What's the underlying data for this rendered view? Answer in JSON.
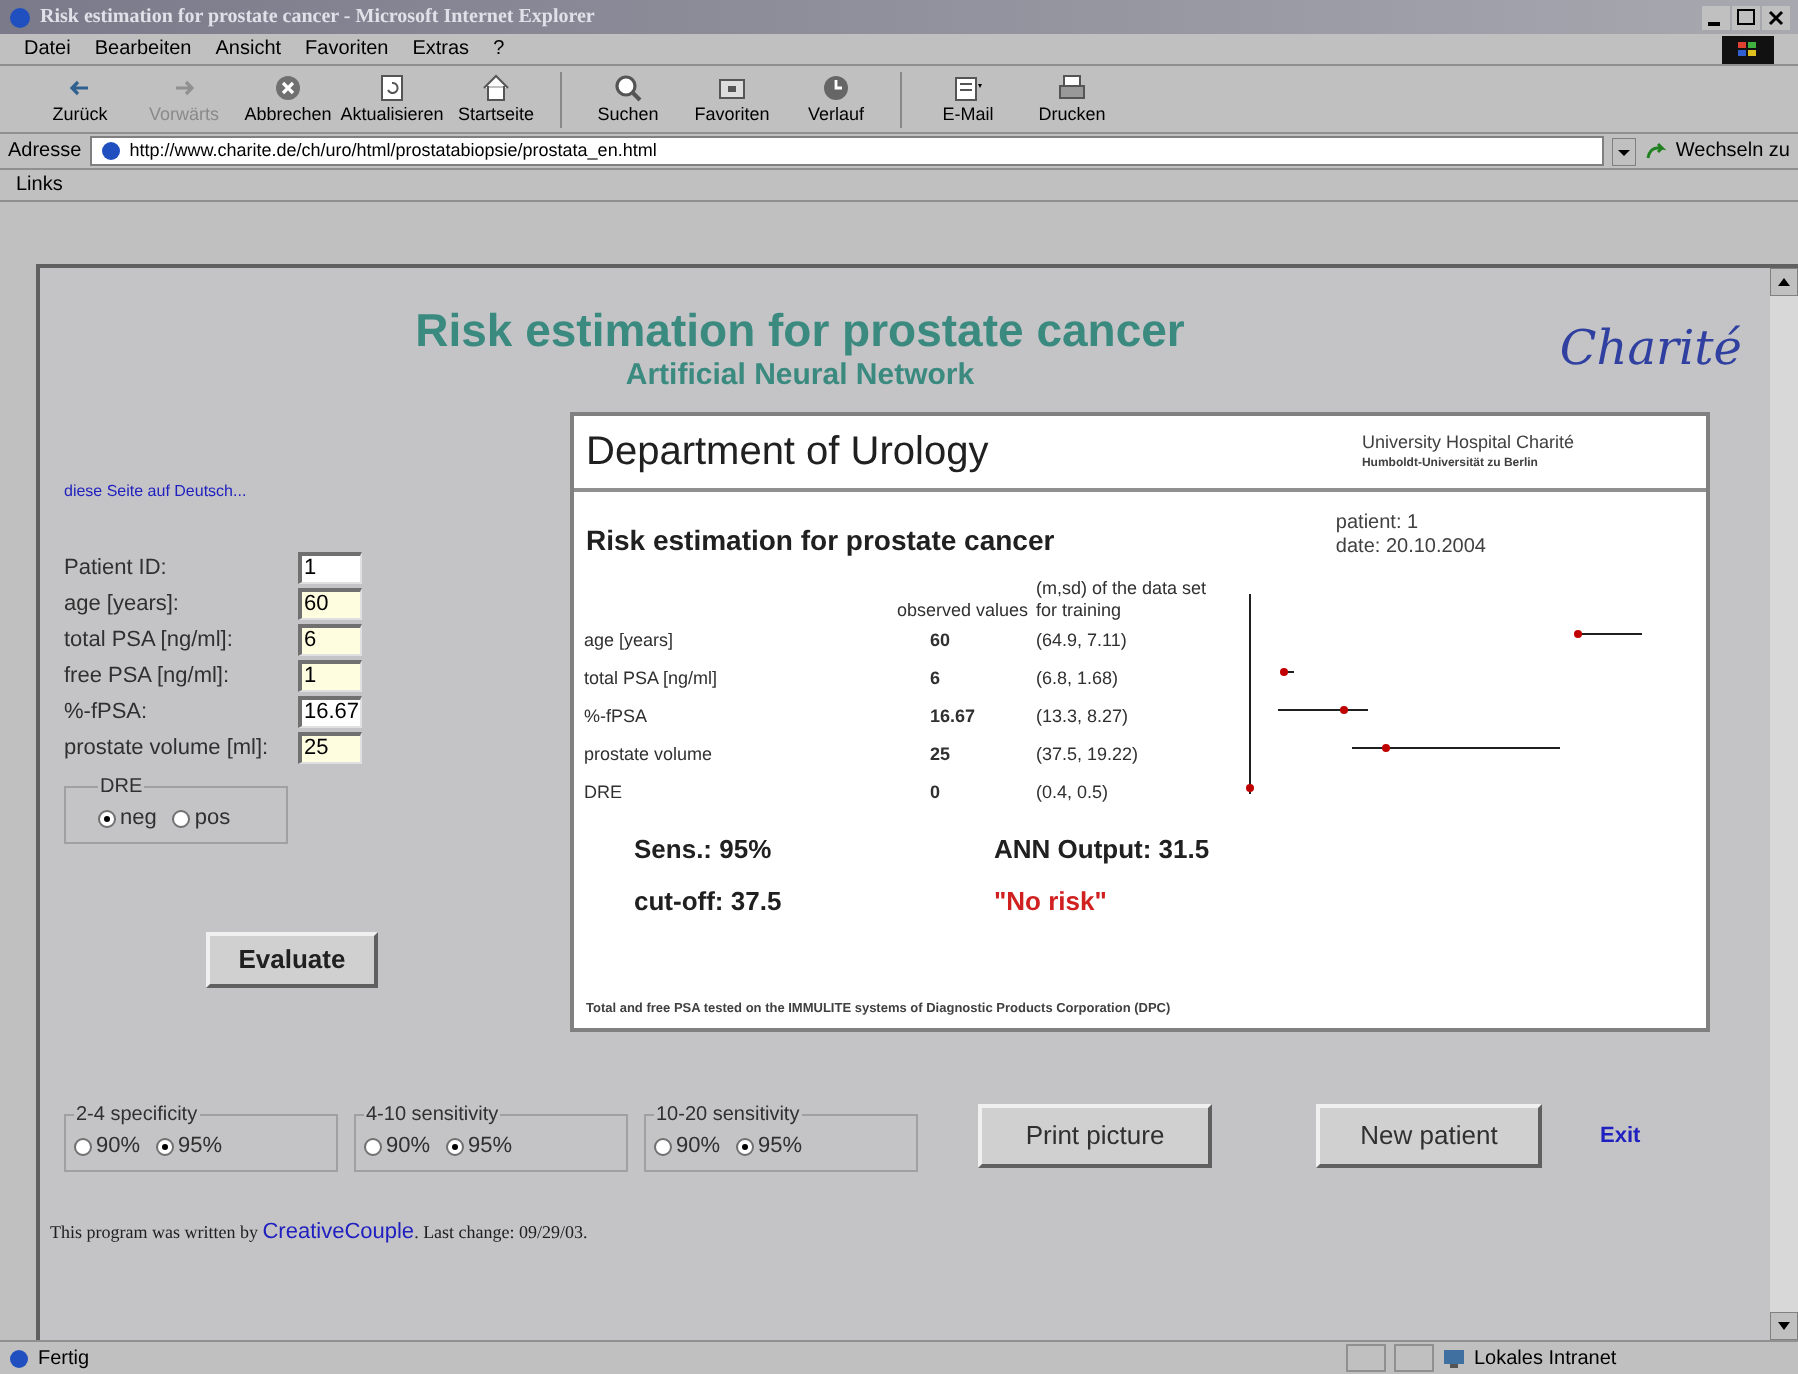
{
  "window": {
    "title": "Risk estimation for prostate cancer - Microsoft Internet Explorer"
  },
  "menu": [
    "Datei",
    "Bearbeiten",
    "Ansicht",
    "Favoriten",
    "Extras",
    "?"
  ],
  "toolbar": [
    {
      "label": "Zurück",
      "disabled": false
    },
    {
      "label": "Vorwärts",
      "disabled": true
    },
    {
      "label": "Abbrechen",
      "disabled": false
    },
    {
      "label": "Aktualisieren",
      "disabled": false
    },
    {
      "label": "Startseite",
      "disabled": false
    },
    {
      "label": "Suchen",
      "disabled": false
    },
    {
      "label": "Favoriten",
      "disabled": false
    },
    {
      "label": "Verlauf",
      "disabled": false
    },
    {
      "label": "E-Mail",
      "disabled": false
    },
    {
      "label": "Drucken",
      "disabled": false
    }
  ],
  "address": {
    "label": "Adresse",
    "value": "http://www.charite.de/ch/uro/html/prostatabiopsie/prostata_en.html",
    "go": "Wechseln zu"
  },
  "links_bar": "Links",
  "page": {
    "title": "Risk estimation for prostate cancer",
    "subtitle": "Artificial Neural Network",
    "logo": "Charité",
    "language_link": "diese Seite auf Deutsch...",
    "fields": [
      {
        "label": "Patient ID:",
        "value": "1",
        "highlighted": false
      },
      {
        "label": "age [years]:",
        "value": "60",
        "highlighted": true
      },
      {
        "label": "total PSA [ng/ml]:",
        "value": "6",
        "highlighted": true
      },
      {
        "label": "free PSA [ng/ml]:",
        "value": "1",
        "highlighted": true
      },
      {
        "label": "%-fPSA:",
        "value": "16.67",
        "highlighted": false
      },
      {
        "label": "prostate volume [ml]:",
        "value": "25",
        "highlighted": true
      }
    ],
    "dre": {
      "legend": "DRE",
      "options": [
        {
          "label": "neg",
          "selected": true
        },
        {
          "label": "pos",
          "selected": false
        }
      ]
    },
    "evaluate_button": "Evaluate",
    "report": {
      "department": "Department of Urology",
      "hospital": "University Hospital Charité",
      "university": "Humboldt-Universität zu Berlin",
      "title": "Risk estimation for prostate cancer",
      "patient": "patient: 1",
      "date": "date: 20.10.2004",
      "columns": [
        "observed values",
        "(m,sd) of the data set for training"
      ],
      "rows": [
        {
          "label": "age [years]",
          "observed": "60",
          "training": "(64.9, 7.11)"
        },
        {
          "label": "total PSA [ng/ml]",
          "observed": "6",
          "training": "(6.8, 1.68)"
        },
        {
          "label": "%-fPSA",
          "observed": "16.67",
          "training": "(13.3, 8.27)"
        },
        {
          "label": "prostate volume",
          "observed": "25",
          "training": "(37.5, 19.22)"
        },
        {
          "label": "DRE",
          "observed": "0",
          "training": "(0.4, 0.5)"
        }
      ],
      "sens": "Sens.: 95%",
      "cutoff": "cut-off: 37.5",
      "output": "ANN Output: 31.5",
      "verdict": "\"No risk\"",
      "footnote": "Total and free PSA tested on the IMMULITE systems of Diagnostic Products Corporation (DPC)"
    },
    "settings": [
      {
        "legend": "2-4 specificity",
        "options": [
          {
            "label": "90%",
            "selected": false
          },
          {
            "label": "95%",
            "selected": true
          }
        ]
      },
      {
        "legend": "4-10 sensitivity",
        "options": [
          {
            "label": "90%",
            "selected": false
          },
          {
            "label": "95%",
            "selected": true
          }
        ]
      },
      {
        "legend": "10-20 sensitivity",
        "options": [
          {
            "label": "90%",
            "selected": false
          },
          {
            "label": "95%",
            "selected": true
          }
        ]
      }
    ],
    "buttons": [
      "Print picture",
      "New patient"
    ],
    "exit_link": "Exit",
    "footer": {
      "before": "This program was written by",
      "link": "CreativeCouple",
      "after": ". Last change: 09/29/03."
    }
  },
  "status_bar": {
    "text": "Fertig",
    "zone": "Lokales Intranet"
  }
}
